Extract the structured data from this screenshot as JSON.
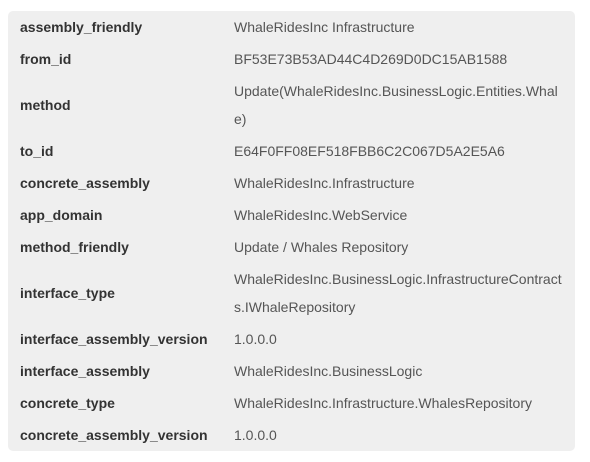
{
  "properties": [
    {
      "key": "assembly_friendly",
      "value": "WhaleRidesInc Infrastructure"
    },
    {
      "key": "from_id",
      "value": "BF53E73B53AD44C4D269D0DC15AB1588"
    },
    {
      "key": "method",
      "value": "Update(WhaleRidesInc.BusinessLogic.Entities.Whale)"
    },
    {
      "key": "to_id",
      "value": "E64F0FF08EF518FBB6C2C067D5A2E5A6"
    },
    {
      "key": "concrete_assembly",
      "value": "WhaleRidesInc.Infrastructure"
    },
    {
      "key": "app_domain",
      "value": "WhaleRidesInc.WebService"
    },
    {
      "key": "method_friendly",
      "value": "Update / Whales Repository"
    },
    {
      "key": "interface_type",
      "value": "WhaleRidesInc.BusinessLogic.InfrastructureContracts.IWhaleRepository"
    },
    {
      "key": "interface_assembly_version",
      "value": "1.0.0.0"
    },
    {
      "key": "interface_assembly",
      "value": "WhaleRidesInc.BusinessLogic"
    },
    {
      "key": "concrete_type",
      "value": "WhaleRidesInc.Infrastructure.WhalesRepository"
    },
    {
      "key": "concrete_assembly_version",
      "value": "1.0.0.0"
    }
  ]
}
